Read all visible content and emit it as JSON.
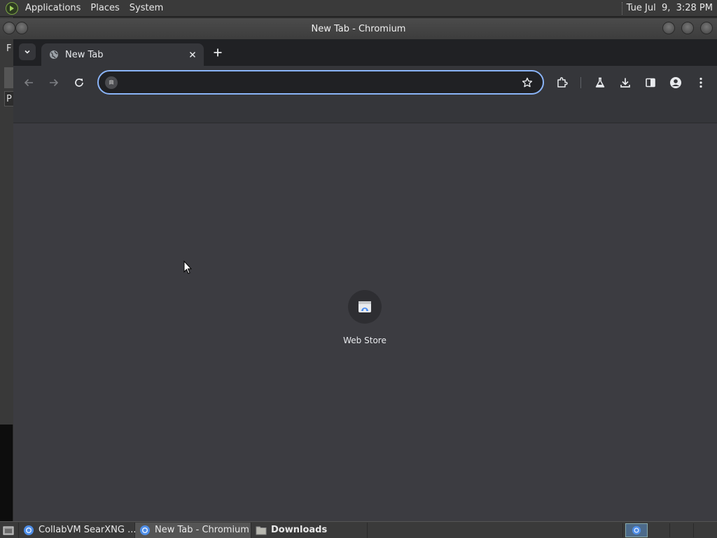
{
  "topbar": {
    "menus": [
      "Applications",
      "Places",
      "System"
    ],
    "clock": "Tue Jul  9,  3:28 PM"
  },
  "background_window": {
    "letters": [
      "F",
      "P"
    ]
  },
  "window": {
    "title": "New Tab - Chromium"
  },
  "browser": {
    "tab": {
      "title": "New Tab"
    },
    "omnibox": {
      "value": "",
      "placeholder": ""
    },
    "toolbar_icons": [
      "back-icon",
      "forward-icon",
      "reload-icon",
      "extensions-icon",
      "labs-flask-icon",
      "downloads-icon",
      "side-panel-icon",
      "profile-icon",
      "kebab-menu-icon"
    ]
  },
  "newtab": {
    "shortcuts": [
      {
        "label": "Web Store",
        "icon": "web-store-icon"
      }
    ]
  },
  "taskbar": {
    "items": [
      {
        "label": "CollabVM SearXNG ...",
        "icon": "chromium-icon"
      },
      {
        "label": "New Tab - Chromium",
        "icon": "chromium-icon"
      },
      {
        "label": "Downloads",
        "icon": "folder-icon"
      }
    ]
  },
  "colors": {
    "accent": "#8ab4f8",
    "tabstrip": "#202124",
    "toolbar": "#35363a",
    "content": "#3c3c41"
  }
}
